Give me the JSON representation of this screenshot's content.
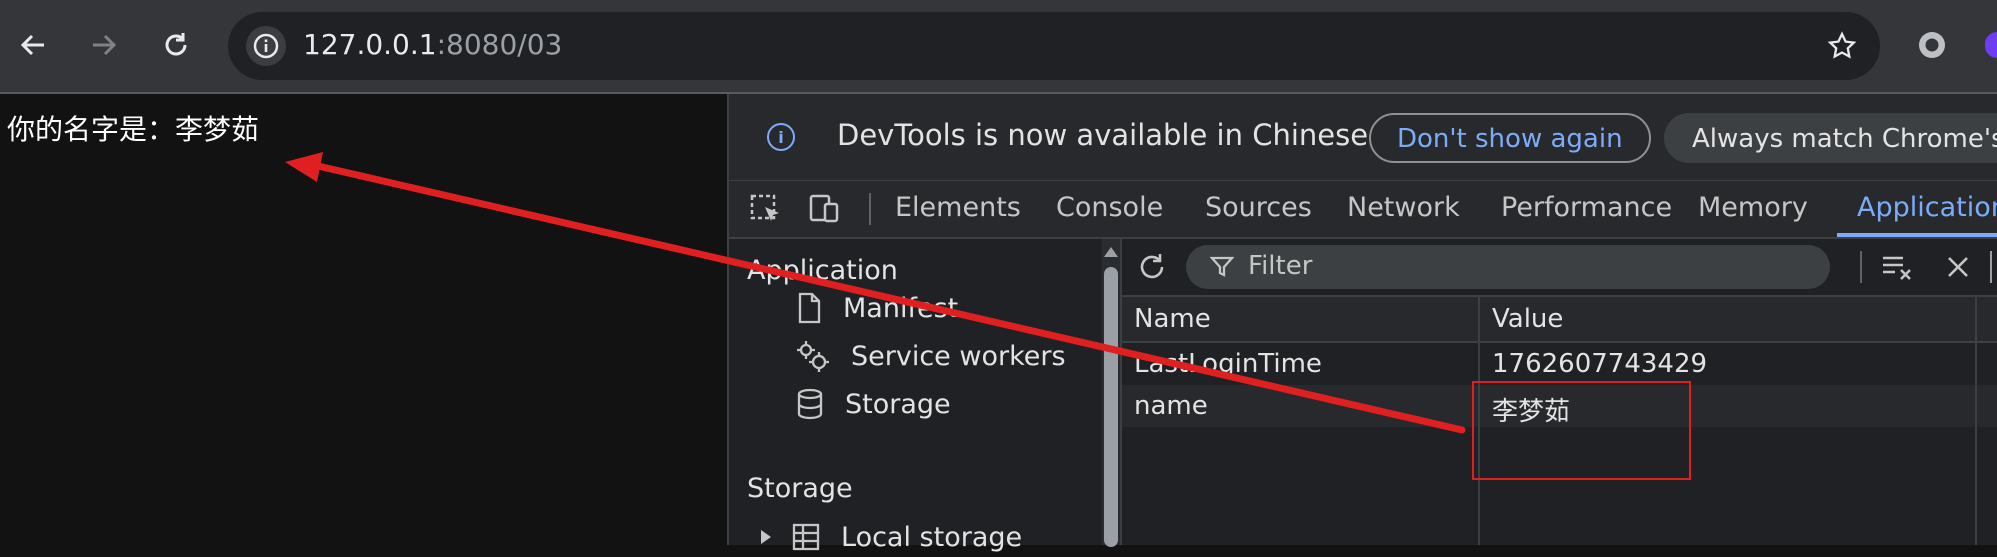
{
  "browser": {
    "url_host": "127.0.0.1",
    "url_path": ":8080/03"
  },
  "page": {
    "text": "你的名字是：李梦茹"
  },
  "devtools": {
    "infobar": {
      "message": "DevTools is now available in Chinese",
      "dismiss_label": "Don't show again",
      "match_label": "Always match Chrome's l"
    },
    "tabs": [
      "Elements",
      "Console",
      "Sources",
      "Network",
      "Performance",
      "Memory",
      "Application"
    ],
    "active_tab": "Application",
    "sidebar": {
      "section_application": "Application",
      "items": [
        "Manifest",
        "Service workers",
        "Storage"
      ],
      "section_storage": "Storage",
      "storage_items": [
        "Local storage"
      ]
    },
    "filter_placeholder": "Filter",
    "table": {
      "columns": [
        "Name",
        "Value"
      ],
      "rows": [
        {
          "name": "LastLoginTime",
          "value": "1762607743429"
        },
        {
          "name": "name",
          "value": "李梦茹"
        }
      ]
    }
  },
  "colors": {
    "accent": "#7cacf8",
    "annotation": "#e02020"
  }
}
